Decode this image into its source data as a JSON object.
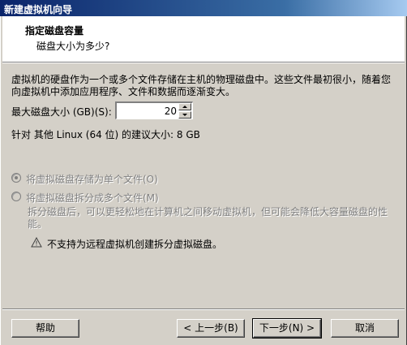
{
  "window": {
    "title": "新建虚拟机向导"
  },
  "header": {
    "title": "指定磁盘容量",
    "subtitle": "磁盘大小为多少?"
  },
  "description": "虚拟机的硬盘作为一个或多个文件存储在主机的物理磁盘中。这些文件最初很小，随着您向虚拟机中添加应用程序、文件和数据而逐渐变大。",
  "disk_size": {
    "label": "最大磁盘大小 (GB)(S):",
    "value": "20"
  },
  "recommended": "针对 其他 Linux (64 位) 的建议大小: 8 GB",
  "options": {
    "single_file": {
      "label": "将虚拟磁盘存储为单个文件(O)",
      "selected": true,
      "enabled": false
    },
    "split_files": {
      "label": "将虚拟磁盘拆分成多个文件(M)",
      "selected": false,
      "enabled": false
    }
  },
  "split_description": "拆分磁盘后，可以更轻松地在计算机之间移动虚拟机，但可能会降低大容量磁盘的性能。",
  "warning": {
    "icon": "warning-icon",
    "text": "不支持为远程虚拟机创建拆分虚拟磁盘。"
  },
  "buttons": {
    "help": "帮助",
    "back": "< 上一步(B)",
    "next": "下一步(N) >",
    "cancel": "取消"
  },
  "colors": {
    "titlebar_start": "#0a246a",
    "titlebar_end": "#a6caf0",
    "face": "#d4d0c8",
    "disabled_text": "#808080"
  }
}
